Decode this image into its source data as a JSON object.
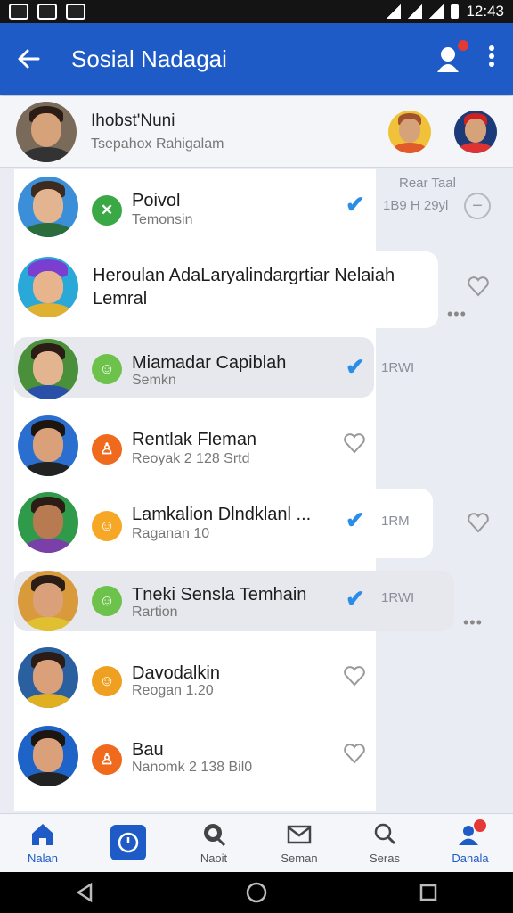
{
  "status_bar": {
    "time": "12:43"
  },
  "app_bar": {
    "title": "Sosial Nadagai",
    "back_icon": "back-arrow-icon",
    "notif_icon": "person-add-icon",
    "more_icon": "more-vert-icon"
  },
  "profile": {
    "name": "Ihobst'Nuni",
    "subtitle": "Tsepahox Rahigalam"
  },
  "chats": [
    {
      "title": "Poivol",
      "subtitle": "Temonsin",
      "icon_color": "#3aa844",
      "icon_glyph": "✕",
      "time": "Rear Taal",
      "time2": "1B9 H 29yl",
      "checked": true,
      "style": "white"
    },
    {
      "title": "Heroulan AdaLaryalindargrtiar Nelaiah",
      "subtitle": "Lemral",
      "icon_color": "",
      "icon_glyph": "",
      "time": "",
      "checked": false,
      "style": "white-wide"
    },
    {
      "title": "Miamadar Capiblah",
      "subtitle": "Semkn",
      "icon_color": "#6cc24a",
      "icon_glyph": "☺",
      "time": "1RWI",
      "checked": true,
      "style": "grey"
    },
    {
      "title": "Rentlak Fleman",
      "subtitle": "Reoyak 2 128 Srtd",
      "icon_color": "#f06a1d",
      "icon_glyph": "♙",
      "time": "",
      "checked": false,
      "style": "white"
    },
    {
      "title": "Lamkalion Dlndklanl ...",
      "subtitle": "Raganan 10",
      "icon_color": "#f7a726",
      "icon_glyph": "☺",
      "time": "1RM",
      "checked": true,
      "style": "white-wide"
    },
    {
      "title": "Tneki Sensla Temhain",
      "subtitle": "Rartion",
      "icon_color": "#6cc24a",
      "icon_glyph": "☺",
      "time": "1RWI",
      "checked": true,
      "style": "grey"
    },
    {
      "title": "Davodalkin",
      "subtitle": "Reogan 1.20",
      "icon_color": "#f0a020",
      "icon_glyph": "☺",
      "time": "",
      "checked": false,
      "style": "white"
    },
    {
      "title": "Bau",
      "subtitle": "Nanomk 2 138 Bil0",
      "icon_color": "#f06a1d",
      "icon_glyph": "♙",
      "time": "",
      "checked": false,
      "style": "white"
    }
  ],
  "bottom_nav": [
    {
      "label": "Nalan",
      "icon": "home-icon"
    },
    {
      "label": "",
      "icon": "timer-icon"
    },
    {
      "label": "Naoit",
      "icon": "search-bubble-icon"
    },
    {
      "label": "Seman",
      "icon": "mail-icon"
    },
    {
      "label": "Seras",
      "icon": "search-icon"
    },
    {
      "label": "Danala",
      "icon": "profile-badge-icon"
    }
  ],
  "colors": {
    "primary": "#1e5bc6",
    "check": "#2a8ee8"
  }
}
